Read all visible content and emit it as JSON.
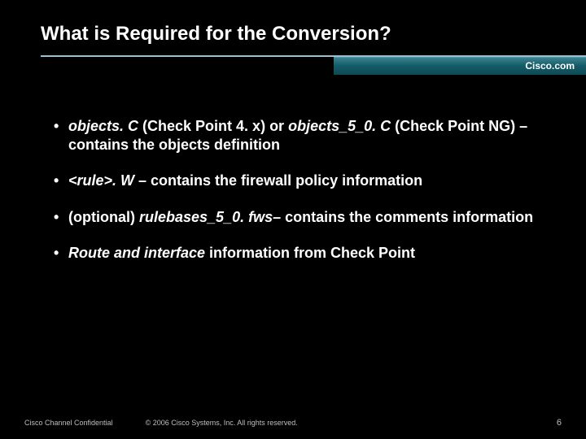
{
  "header": {
    "title": "What is Required for the Conversion?",
    "brand": "Cisco.com"
  },
  "bullets": [
    {
      "segments": [
        {
          "text": "objects. C",
          "style": "em"
        },
        {
          "text": " (Check Point 4. x) or ",
          "style": ""
        },
        {
          "text": "objects_5_0. C",
          "style": "em"
        },
        {
          "text": " (Check Point NG) – contains the objects definition",
          "style": ""
        }
      ]
    },
    {
      "segments": [
        {
          "text": "<rule>. W",
          "style": "em"
        },
        {
          "text": " – contains the firewall policy information",
          "style": ""
        }
      ]
    },
    {
      "segments": [
        {
          "text": "(optional) ",
          "style": ""
        },
        {
          "text": "rulebases_5_0. fws",
          "style": "em"
        },
        {
          "text": "– contains the comments information",
          "style": ""
        }
      ]
    },
    {
      "segments": [
        {
          "text": "Route and interface",
          "style": "em"
        },
        {
          "text": " information from Check Point",
          "style": ""
        }
      ]
    }
  ],
  "footer": {
    "left": "Cisco Channel Confidential",
    "center": "© 2006 Cisco Systems, Inc. All rights reserved.",
    "page": "6"
  }
}
